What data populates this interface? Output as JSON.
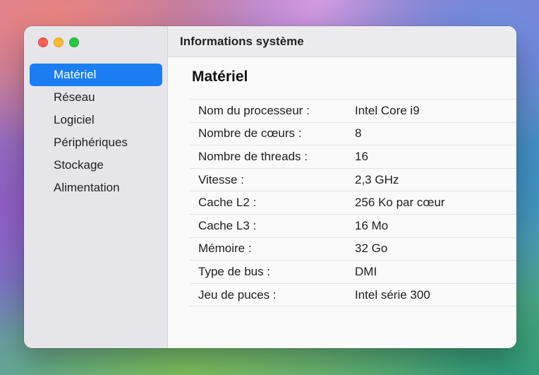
{
  "window": {
    "title": "Informations système",
    "traffic_lights": {
      "close_color": "#ff5f57",
      "minimize_color": "#febc2e",
      "maximize_color": "#28c840"
    }
  },
  "sidebar": {
    "accent_color": "#1a7ef2",
    "selected": "Matériel",
    "items": [
      {
        "label": "Matériel"
      },
      {
        "label": "Réseau"
      },
      {
        "label": "Logiciel"
      },
      {
        "label": "Périphériques"
      },
      {
        "label": "Stockage"
      },
      {
        "label": "Alimentation"
      }
    ]
  },
  "main": {
    "section_title": "Matériel",
    "rows": [
      {
        "key": "Nom du processeur :",
        "value": "Intel Core i9"
      },
      {
        "key": "Nombre de cœurs :",
        "value": "8"
      },
      {
        "key": "Nombre de threads :",
        "value": "16"
      },
      {
        "key": "Vitesse :",
        "value": "2,3 GHz"
      },
      {
        "key": "Cache L2 :",
        "value": "256 Ko par cœur"
      },
      {
        "key": "Cache L3 :",
        "value": "16 Mo"
      },
      {
        "key": "Mémoire :",
        "value": "32 Go"
      },
      {
        "key": "Type de bus :",
        "value": "DMI"
      },
      {
        "key": "Jeu de puces :",
        "value": "Intel série 300"
      }
    ]
  }
}
